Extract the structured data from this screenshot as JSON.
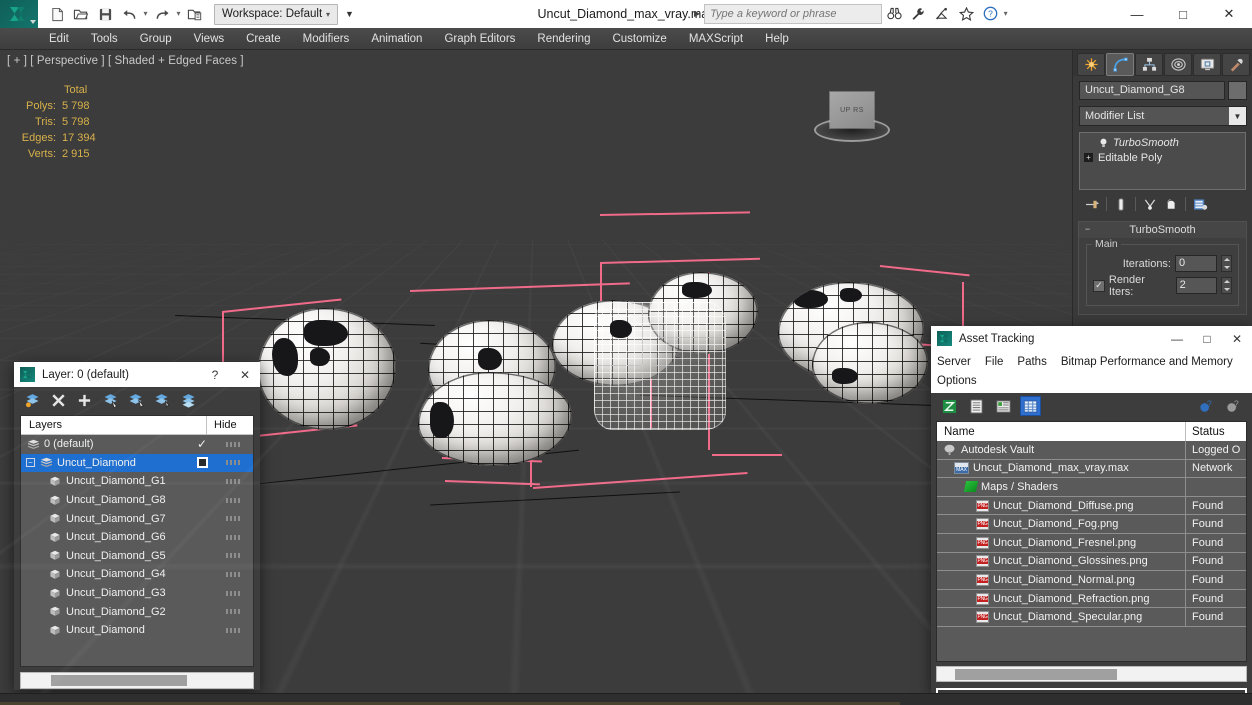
{
  "app": {
    "title": "Uncut_Diamond_max_vray.max",
    "workspace": "Workspace: Default",
    "search_placeholder": "Type a keyword or phrase"
  },
  "quick_access": [
    {
      "name": "new-file-icon",
      "label": "New"
    },
    {
      "name": "open-file-icon",
      "label": "Open"
    },
    {
      "name": "save-file-icon",
      "label": "Save"
    },
    {
      "name": "undo-icon",
      "label": "Undo"
    },
    {
      "name": "redo-icon",
      "label": "Redo"
    },
    {
      "name": "project-folder-icon",
      "label": "Set Project Folder"
    }
  ],
  "title_right_icons": [
    {
      "name": "binoculars-icon"
    },
    {
      "name": "wrench-icon"
    },
    {
      "name": "satellite-icon"
    },
    {
      "name": "star-icon"
    },
    {
      "name": "help-circle-icon"
    }
  ],
  "window_controls": {
    "minimize": "—",
    "maximize": "□",
    "close": "✕"
  },
  "menu": [
    {
      "label": "Edit"
    },
    {
      "label": "Tools"
    },
    {
      "label": "Group"
    },
    {
      "label": "Views"
    },
    {
      "label": "Create"
    },
    {
      "label": "Modifiers"
    },
    {
      "label": "Animation"
    },
    {
      "label": "Graph Editors"
    },
    {
      "label": "Rendering"
    },
    {
      "label": "Customize"
    },
    {
      "label": "MAXScript"
    },
    {
      "label": "Help"
    }
  ],
  "viewport": {
    "label": "[ + ] [ Perspective ] [ Shaded + Edged Faces ]",
    "stats_header": "Total",
    "stats": [
      {
        "label": "Polys:",
        "value": "5 798"
      },
      {
        "label": "Tris:",
        "value": "5 798"
      },
      {
        "label": "Edges:",
        "value": "17 394"
      },
      {
        "label": "Verts:",
        "value": "2 915"
      }
    ],
    "viewcube_faces": "UP  RS",
    "selection_color": "#f06a8a",
    "background_color": "#3c3c3c",
    "stats_color": "#d8b14a"
  },
  "command_panel": {
    "tabs": [
      {
        "name": "create-tab",
        "active": false
      },
      {
        "name": "modify-tab",
        "active": true
      },
      {
        "name": "hierarchy-tab",
        "active": false
      },
      {
        "name": "motion-tab",
        "active": false
      },
      {
        "name": "display-tab",
        "active": false
      },
      {
        "name": "utilities-tab",
        "active": false
      }
    ],
    "object_name": "Uncut_Diamond_G8",
    "modifier_list_label": "Modifier List",
    "modifier_stack": [
      {
        "label": "TurboSmooth",
        "italic": true
      },
      {
        "label": "Editable Poly",
        "italic": false
      }
    ],
    "stack_buttons": [
      {
        "name": "pin-stack-icon"
      },
      {
        "name": "show-end-result-icon"
      },
      {
        "name": "make-unique-icon"
      },
      {
        "name": "remove-modifier-icon"
      },
      {
        "name": "configure-modifier-sets-icon"
      }
    ],
    "rollout": {
      "title": "TurboSmooth",
      "group_label": "Main",
      "params": [
        {
          "label": "Iterations:",
          "value": "0",
          "checkbox": false,
          "checked": false
        },
        {
          "label": "Render Iters:",
          "value": "2",
          "checkbox": true,
          "checked": true
        }
      ]
    }
  },
  "layer_dialog": {
    "title": "Layer: 0 (default)",
    "help_glyph": "?",
    "close_glyph": "✕",
    "toolbar": [
      {
        "name": "create-new-layer-icon"
      },
      {
        "name": "delete-layer-icon"
      },
      {
        "name": "add-selection-to-layer-icon"
      },
      {
        "name": "select-objects-in-layer-icon"
      },
      {
        "name": "select-highlighted-objects-icon"
      },
      {
        "name": "highlight-selected-objects-icon"
      },
      {
        "name": "hide-unhide-layer-icon"
      }
    ],
    "columns": {
      "name": "Layers",
      "hide": "Hide"
    },
    "rows": [
      {
        "label": "0 (default)",
        "type": "layer",
        "indent": 0,
        "selected": false,
        "hide_state": "check",
        "expander": false
      },
      {
        "label": "Uncut_Diamond",
        "type": "layer",
        "indent": 0,
        "selected": true,
        "hide_state": "box",
        "expander": true
      },
      {
        "label": "Uncut_Diamond_G1",
        "type": "object",
        "indent": 1,
        "selected": false,
        "hide_state": "none",
        "expander": false
      },
      {
        "label": "Uncut_Diamond_G8",
        "type": "object",
        "indent": 1,
        "selected": false,
        "hide_state": "none",
        "expander": false
      },
      {
        "label": "Uncut_Diamond_G7",
        "type": "object",
        "indent": 1,
        "selected": false,
        "hide_state": "none",
        "expander": false
      },
      {
        "label": "Uncut_Diamond_G6",
        "type": "object",
        "indent": 1,
        "selected": false,
        "hide_state": "none",
        "expander": false
      },
      {
        "label": "Uncut_Diamond_G5",
        "type": "object",
        "indent": 1,
        "selected": false,
        "hide_state": "none",
        "expander": false
      },
      {
        "label": "Uncut_Diamond_G4",
        "type": "object",
        "indent": 1,
        "selected": false,
        "hide_state": "none",
        "expander": false
      },
      {
        "label": "Uncut_Diamond_G3",
        "type": "object",
        "indent": 1,
        "selected": false,
        "hide_state": "none",
        "expander": false
      },
      {
        "label": "Uncut_Diamond_G2",
        "type": "object",
        "indent": 1,
        "selected": false,
        "hide_state": "none",
        "expander": false
      },
      {
        "label": "Uncut_Diamond",
        "type": "object",
        "indent": 1,
        "selected": false,
        "hide_state": "none",
        "expander": false
      }
    ]
  },
  "asset_dialog": {
    "title": "Asset Tracking",
    "window_controls": {
      "minimize": "—",
      "maximize": "□",
      "close": "✕"
    },
    "menus_row1": [
      "Server",
      "File",
      "Paths",
      "Bitmap Performance and Memory"
    ],
    "menus_row2": [
      "Options"
    ],
    "toolbar": [
      {
        "name": "refresh-assets-icon",
        "active": false
      },
      {
        "name": "list-view-icon",
        "active": false
      },
      {
        "name": "detail-view-icon",
        "active": false
      },
      {
        "name": "grid-view-icon",
        "active": true
      }
    ],
    "toolbar_right": [
      {
        "name": "help-blue-icon"
      },
      {
        "name": "help-gray-icon"
      }
    ],
    "columns": {
      "name": "Name",
      "status": "Status"
    },
    "rows": [
      {
        "label": "Autodesk Vault",
        "status": "Logged O",
        "indent": 0,
        "icon": "vault-icon"
      },
      {
        "label": "Uncut_Diamond_max_vray.max",
        "status": "Network",
        "indent": 1,
        "icon": "max-file-icon"
      },
      {
        "label": "Maps / Shaders",
        "status": "",
        "indent": 2,
        "icon": "maps-shaders-icon"
      },
      {
        "label": "Uncut_Diamond_Diffuse.png",
        "status": "Found",
        "indent": 3,
        "icon": "png-file-icon"
      },
      {
        "label": "Uncut_Diamond_Fog.png",
        "status": "Found",
        "indent": 3,
        "icon": "png-file-icon"
      },
      {
        "label": "Uncut_Diamond_Fresnel.png",
        "status": "Found",
        "indent": 3,
        "icon": "png-file-icon"
      },
      {
        "label": "Uncut_Diamond_Glossines.png",
        "status": "Found",
        "indent": 3,
        "icon": "png-file-icon"
      },
      {
        "label": "Uncut_Diamond_Normal.png",
        "status": "Found",
        "indent": 3,
        "icon": "png-file-icon"
      },
      {
        "label": "Uncut_Diamond_Refraction.png",
        "status": "Found",
        "indent": 3,
        "icon": "png-file-icon"
      },
      {
        "label": "Uncut_Diamond_Specular.png",
        "status": "Found",
        "indent": 3,
        "icon": "png-file-icon"
      }
    ]
  }
}
